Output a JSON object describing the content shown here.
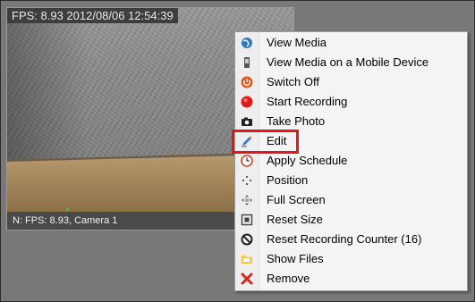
{
  "camera": {
    "overlay_text": "FPS: 8.93 2012/08/06 12:54:39",
    "status_text": "N: FPS: 8.93, Camera 1"
  },
  "context_menu": {
    "items": [
      {
        "label": "View Media",
        "icon": "globe-icon"
      },
      {
        "label": "View Media on a Mobile Device",
        "icon": "mobile-device-icon"
      },
      {
        "label": "Switch Off",
        "icon": "power-icon"
      },
      {
        "label": "Start Recording",
        "icon": "record-icon"
      },
      {
        "label": "Take Photo",
        "icon": "camera-icon"
      },
      {
        "label": "Edit",
        "icon": "edit-icon"
      },
      {
        "label": "Apply Schedule",
        "icon": "clock-icon"
      },
      {
        "label": "Position",
        "icon": "position-icon"
      },
      {
        "label": "Full Screen",
        "icon": "fullscreen-icon"
      },
      {
        "label": "Reset Size",
        "icon": "reset-size-icon"
      },
      {
        "label": "Reset Recording Counter (16)",
        "icon": "no-entry-icon"
      },
      {
        "label": "Show Files",
        "icon": "folder-icon"
      },
      {
        "label": "Remove",
        "icon": "remove-icon"
      }
    ],
    "highlighted_item": "Edit",
    "highlight_color": "#e4161c"
  }
}
